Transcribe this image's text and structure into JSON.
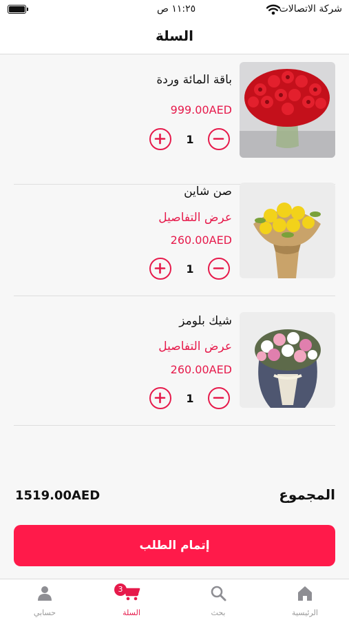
{
  "status_bar": {
    "carrier": "شركة الاتصالات",
    "time": "١١:٢٥ ص"
  },
  "header": {
    "title": "السلة"
  },
  "cart_items": [
    {
      "name": "باقة المائة وردة",
      "details_link": "",
      "price": "999.00AED",
      "quantity": "1"
    },
    {
      "name": "صن شاين",
      "details_link": "عرض التفاصيل",
      "price": "260.00AED",
      "quantity": "1"
    },
    {
      "name": "شيك بلومز",
      "details_link": "عرض التفاصيل",
      "price": "260.00AED",
      "quantity": "1"
    }
  ],
  "total": {
    "label": "المجموع",
    "value": "1519.00AED"
  },
  "checkout_label": "إتمام الطلب",
  "tab_bar": {
    "cart_badge": "3",
    "items": [
      {
        "label": "الرئيسية",
        "icon": "home-icon"
      },
      {
        "label": "بحث",
        "icon": "search-icon"
      },
      {
        "label": "السلة",
        "icon": "cart-icon",
        "active": true
      },
      {
        "label": "حسابي",
        "icon": "profile-icon"
      }
    ]
  },
  "colors": {
    "accent": "#e61a4b",
    "button": "#ff1a4a",
    "background": "#f7f7f7"
  }
}
